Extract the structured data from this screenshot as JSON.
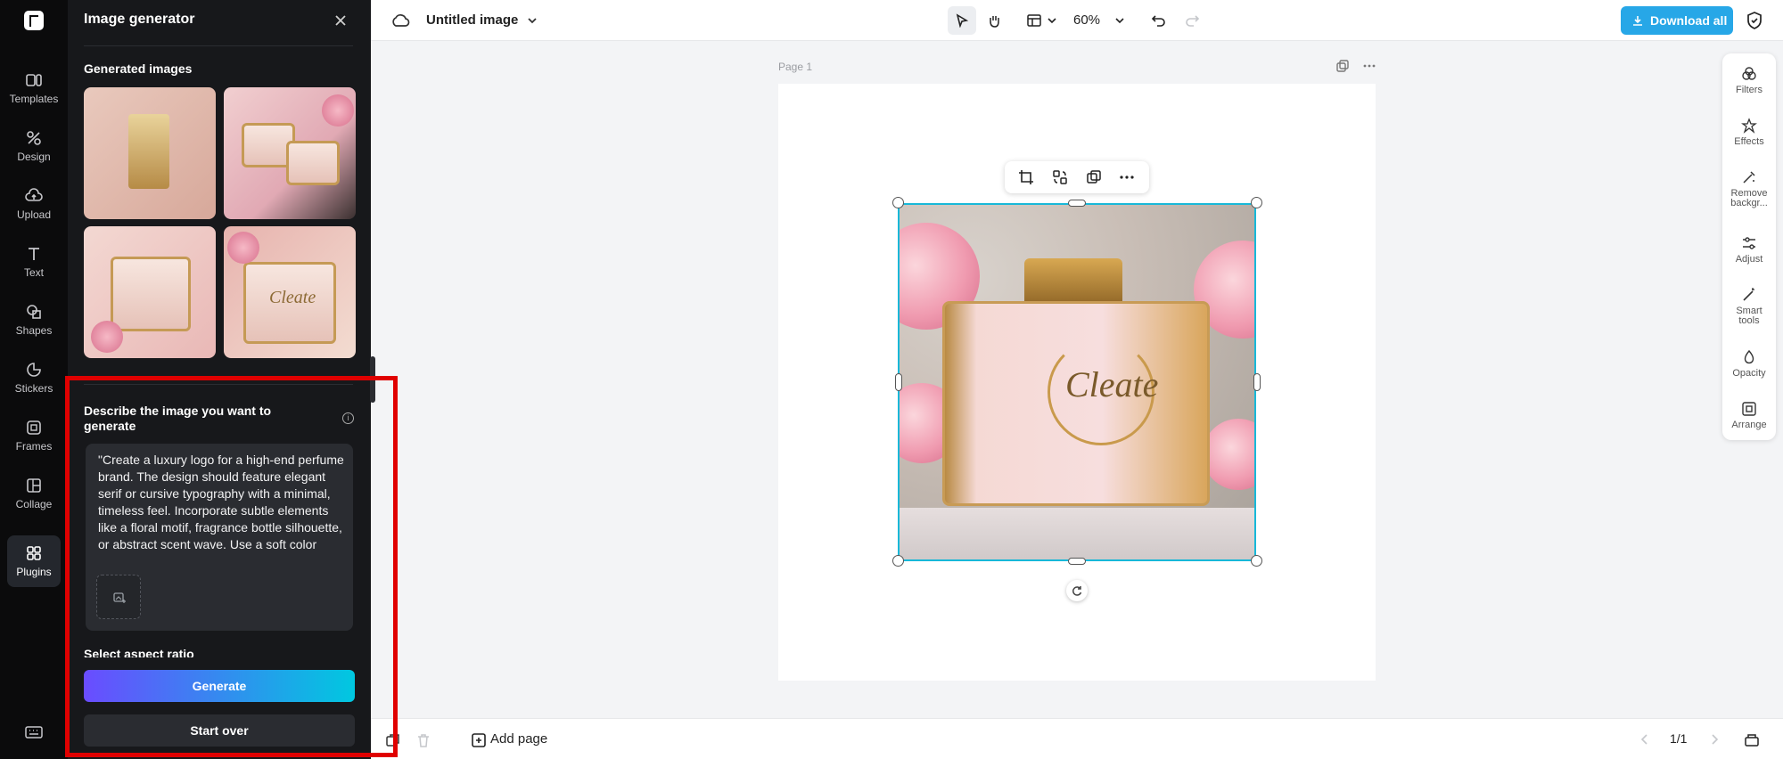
{
  "rail": {
    "items": [
      {
        "label": "Templates"
      },
      {
        "label": "Design"
      },
      {
        "label": "Upload"
      },
      {
        "label": "Text"
      },
      {
        "label": "Shapes"
      },
      {
        "label": "Stickers"
      },
      {
        "label": "Frames"
      },
      {
        "label": "Collage"
      },
      {
        "label": "Plugins"
      }
    ]
  },
  "panel": {
    "title": "Image generator",
    "generated_label": "Generated images",
    "thumb_text": "Cleate",
    "describe_label": "Describe the image you want to generate",
    "prompt": "\"Create a luxury logo for a high-end perfume brand. The design should feature elegant serif or cursive typography with a minimal, timeless feel. Incorporate subtle elements like a floral motif, fragrance bottle silhouette, or abstract scent wave. Use a soft color",
    "aspect_label": "Select aspect ratio",
    "generate_label": "Generate",
    "start_over_label": "Start over"
  },
  "topbar": {
    "doc_title": "Untitled image",
    "zoom": "60%",
    "download_label": "Download all"
  },
  "canvas": {
    "page_label": "Page 1",
    "image_brand_text": "Cleate"
  },
  "props": {
    "items": [
      {
        "label": "Filters"
      },
      {
        "label": "Effects"
      },
      {
        "label": "Remove backgr..."
      },
      {
        "label": "Adjust"
      },
      {
        "label": "Smart tools"
      },
      {
        "label": "Opacity"
      },
      {
        "label": "Arrange"
      }
    ]
  },
  "bottombar": {
    "add_page_label": "Add page",
    "page_indicator": "1/1"
  },
  "colors": {
    "accent": "#27a7e7",
    "selection": "#18b8d8",
    "highlight": "#e00000",
    "panel_bg": "#17181b"
  }
}
